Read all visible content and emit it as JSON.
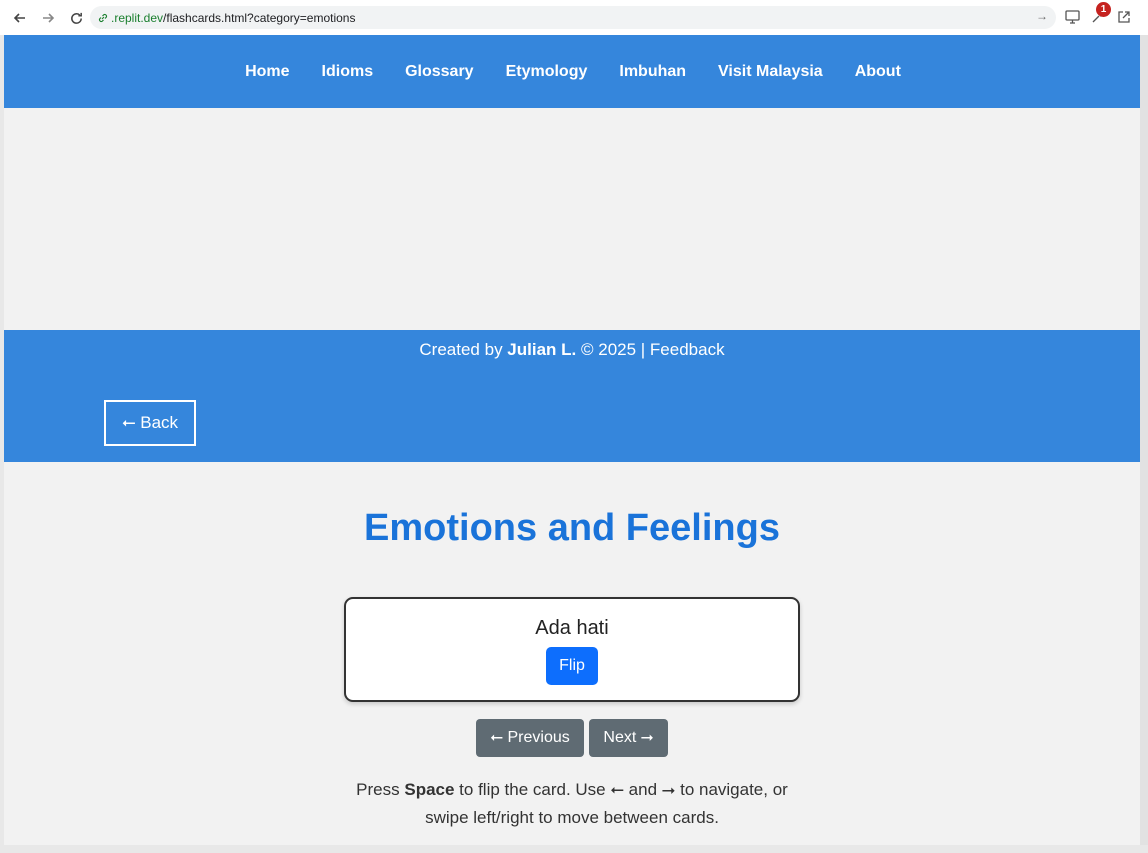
{
  "browser": {
    "url_domain": ".replit.dev",
    "url_path": "/flashcards.html?category=emotions",
    "badge_count": "1"
  },
  "nav": {
    "items": [
      "Home",
      "Idioms",
      "Glossary",
      "Etymology",
      "Imbuhan",
      "Visit Malaysia",
      "About"
    ]
  },
  "footer": {
    "prefix": "Created by ",
    "author": "Julian L.",
    "suffix": " © 2025 | ",
    "feedback": "Feedback"
  },
  "back_label": "⭠ Back",
  "title": "Emotions and Feelings",
  "card": {
    "text": "Ada hati",
    "flip_label": "Flip"
  },
  "pager": {
    "previous_label": "⭠ Previous",
    "next_label": "Next ⭢"
  },
  "help": {
    "press": "Press ",
    "key": "Space",
    "rest": " to flip the card. Use ⭠ and ⭢ to navigate, or swipe left/right to move between cards."
  },
  "colors": {
    "brand_blue": "#3586dc",
    "title_blue": "#1a73d9",
    "flip_blue": "#0d6efd",
    "pager_gray": "#5f6b73"
  }
}
